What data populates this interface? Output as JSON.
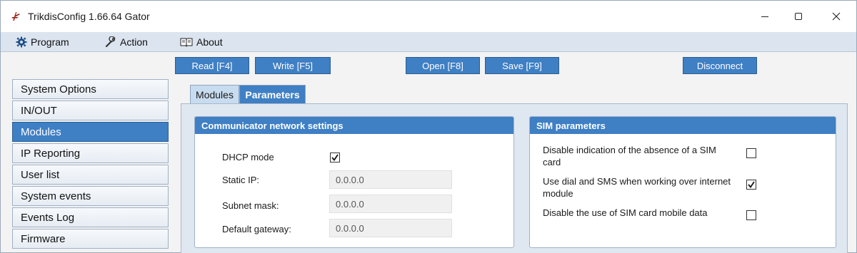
{
  "window": {
    "title": "TrikdisConfig 1.66.64   Gator",
    "controls": {
      "minimize": "—",
      "maximize": "☐",
      "close": "✕"
    }
  },
  "menu": [
    {
      "label": "Program",
      "icon": "gear-icon"
    },
    {
      "label": "Action",
      "icon": "wrench-icon"
    },
    {
      "label": "About",
      "icon": "book-icon"
    }
  ],
  "toolbar": {
    "read": "Read [F4]",
    "write": "Write [F5]",
    "open": "Open [F8]",
    "save": "Save [F9]",
    "disconnect": "Disconnect"
  },
  "sidebar": {
    "items": [
      {
        "label": "System Options",
        "active": false
      },
      {
        "label": "IN/OUT",
        "active": false
      },
      {
        "label": "Modules",
        "active": true
      },
      {
        "label": "IP Reporting",
        "active": false
      },
      {
        "label": "User list",
        "active": false
      },
      {
        "label": "System events",
        "active": false
      },
      {
        "label": "Events Log",
        "active": false
      },
      {
        "label": "Firmware",
        "active": false
      }
    ]
  },
  "tabs": [
    {
      "label": "Modules",
      "active": false
    },
    {
      "label": "Parameters",
      "active": true
    }
  ],
  "network": {
    "title": "Communicator network settings",
    "dhcp_label": "DHCP mode",
    "dhcp_checked": true,
    "static_ip_label": "Static IP:",
    "static_ip_value": "0.0.0.0",
    "subnet_label": "Subnet mask:",
    "subnet_value": "0.0.0.0",
    "gateway_label": "Default gateway:",
    "gateway_value": "0.0.0.0"
  },
  "sim": {
    "title": "SIM parameters",
    "options": [
      {
        "label": "Disable indication of the absence of a SIM card",
        "checked": false
      },
      {
        "label": "Use dial and SMS when working over internet module",
        "checked": true
      },
      {
        "label": "Disable the use of SIM card mobile data",
        "checked": false
      }
    ]
  },
  "colors": {
    "accent": "#3f7fc4",
    "menubar": "#dbe4ef",
    "panel": "#dfe7f0"
  }
}
